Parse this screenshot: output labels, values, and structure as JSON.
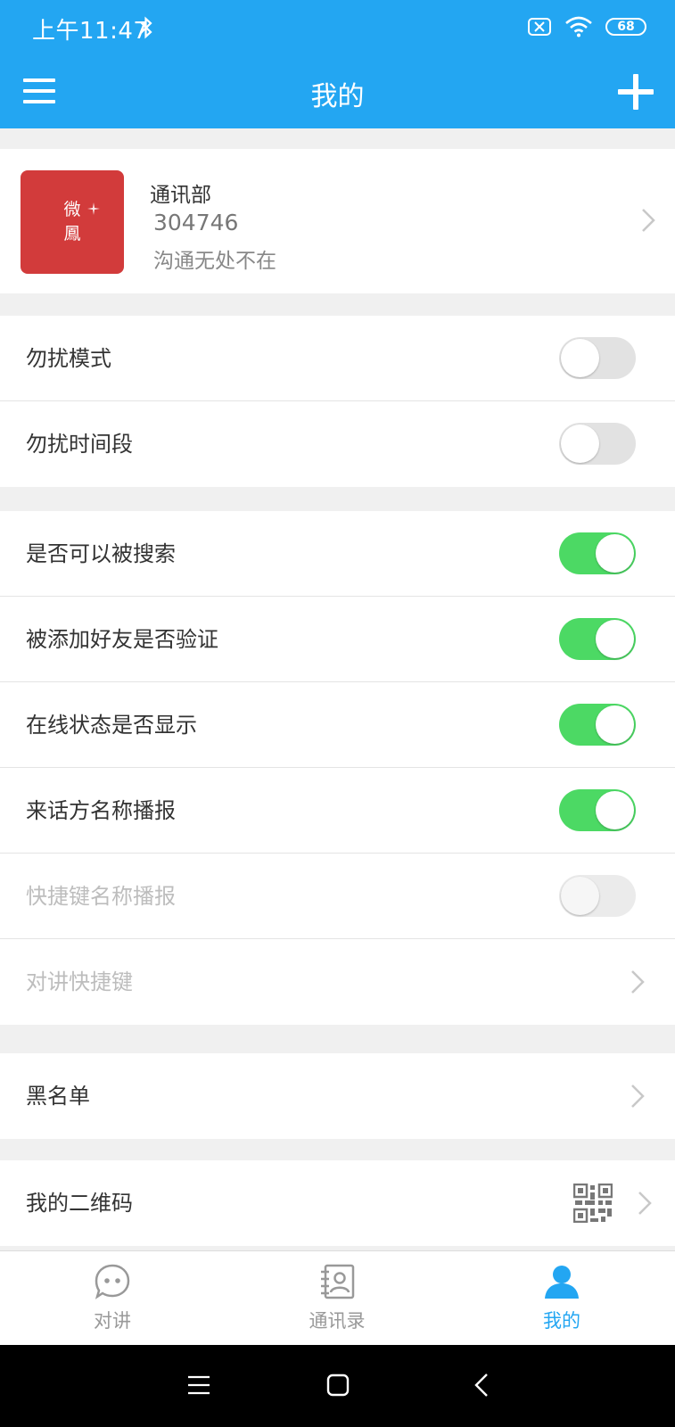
{
  "status_bar": {
    "time": "上午11:47",
    "battery": "68"
  },
  "app_bar": {
    "title": "我的"
  },
  "profile": {
    "logo_text_1": "微",
    "logo_text_2": "鳳",
    "name": "通讯部",
    "id": "304746",
    "motto": "沟通无处不在"
  },
  "settings": {
    "dnd_mode": {
      "label": "勿扰模式",
      "on": false
    },
    "dnd_period": {
      "label": "勿扰时间段",
      "on": false
    },
    "searchable": {
      "label": "是否可以被搜索",
      "on": true
    },
    "friend_verify": {
      "label": "被添加好友是否验证",
      "on": true
    },
    "online_status": {
      "label": "在线状态是否显示",
      "on": true
    },
    "caller_announce": {
      "label": "来话方名称播报",
      "on": true
    },
    "shortcut_announce": {
      "label": "快捷键名称播报",
      "on": false,
      "enabled": false
    },
    "talk_shortcut": {
      "label": "对讲快捷键",
      "enabled": false
    },
    "blacklist": {
      "label": "黑名单"
    },
    "qr_code": {
      "label": "我的二维码"
    }
  },
  "tabs": [
    {
      "label": "对讲",
      "icon": "chat-bubble-icon",
      "active": false
    },
    {
      "label": "通讯录",
      "icon": "contacts-book-icon",
      "active": false
    },
    {
      "label": "我的",
      "icon": "person-icon",
      "active": true
    }
  ],
  "colors": {
    "primary": "#23a6f2",
    "toggle_on": "#4cd964",
    "logo_red": "#d23b3b"
  }
}
